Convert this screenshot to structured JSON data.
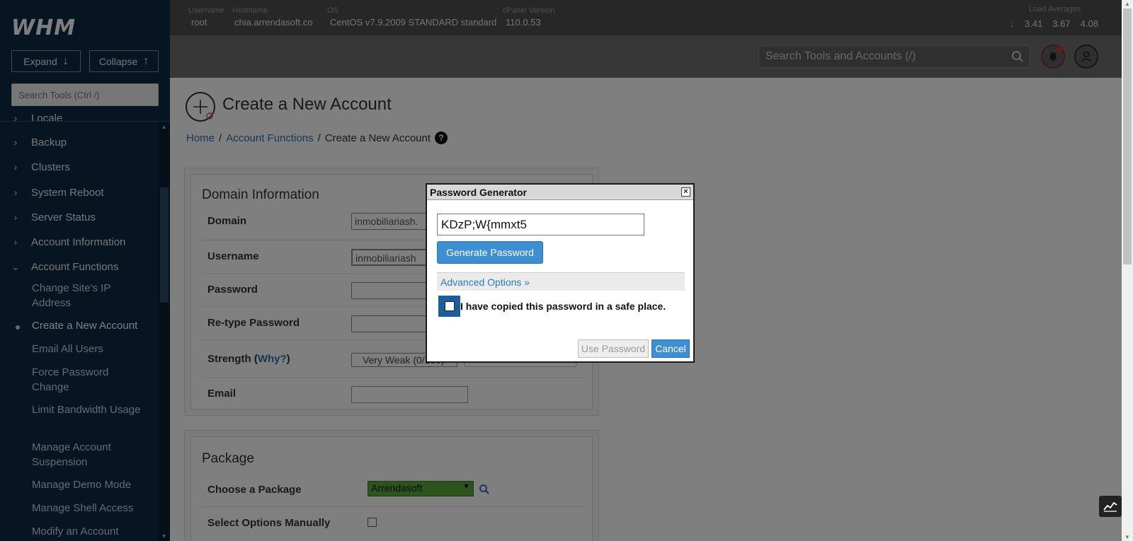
{
  "sidebar": {
    "logo": "WHM",
    "expand_label": "Expand",
    "collapse_label": "Collapse",
    "search_placeholder": "Search Tools (Ctrl /)",
    "partial_top": "Locale",
    "sections": [
      "Backup",
      "Clusters",
      "System Reboot",
      "Server Status",
      "Account Information",
      "Account Functions"
    ],
    "sub_items": [
      "Change Site's IP Address",
      "Create a New Account",
      "Email All Users",
      "Force Password Change",
      "Limit Bandwidth Usage",
      "Manage Account Suspension",
      "Manage Demo Mode",
      "Manage Shell Access",
      "Modify an Account"
    ]
  },
  "topbar": {
    "username_label": "Username",
    "username": "root",
    "hostname_label": "Hostname",
    "hostname": "chia.arrendasoft.co",
    "os_label": "OS",
    "os": "CentOS v7.9.2009 STANDARD standard",
    "cpanel_label": "cPanel Version",
    "cpanel_version": "110.0.53",
    "load_label": "Load Averages",
    "load_values": [
      "3.41",
      "3.67",
      "4.08"
    ]
  },
  "header": {
    "search_placeholder": "Search Tools and Accounts (/)"
  },
  "page": {
    "title": "Create a New Account",
    "breadcrumb": [
      "Home",
      "Account Functions",
      "Create a New Account"
    ],
    "sep": "/",
    "help": "?",
    "domain_panel": {
      "heading": "Domain Information",
      "domain_label": "Domain",
      "domain_value": "inmobiliariash.",
      "username_label": "Username",
      "username_value": "inmobiliariash",
      "password_label": "Password",
      "retype_label": "Re-type Password",
      "strength_label": "Strength (",
      "strength_why": "Why?",
      "strength_close": ")",
      "strength_value": "Very Weak (0/100)",
      "email_label": "Email"
    },
    "package_panel": {
      "heading": "Package",
      "choose_label": "Choose a Package",
      "package_value": "Arrendasoft",
      "manual_label": "Select Options Manually"
    }
  },
  "dialog": {
    "title": "Password Generator",
    "close": "×",
    "password": "KDzP;W{mmxt5",
    "generate_label": "Generate Password",
    "advanced_label": "Advanced Options »",
    "copied_label": "I have copied this password in a safe place.",
    "use_label": "Use Password",
    "cancel_label": "Cancel"
  },
  "colors": {
    "sidebar_bg": "#0f2a44",
    "primary_button": "#3d8fd1",
    "link": "#2a70b2"
  }
}
